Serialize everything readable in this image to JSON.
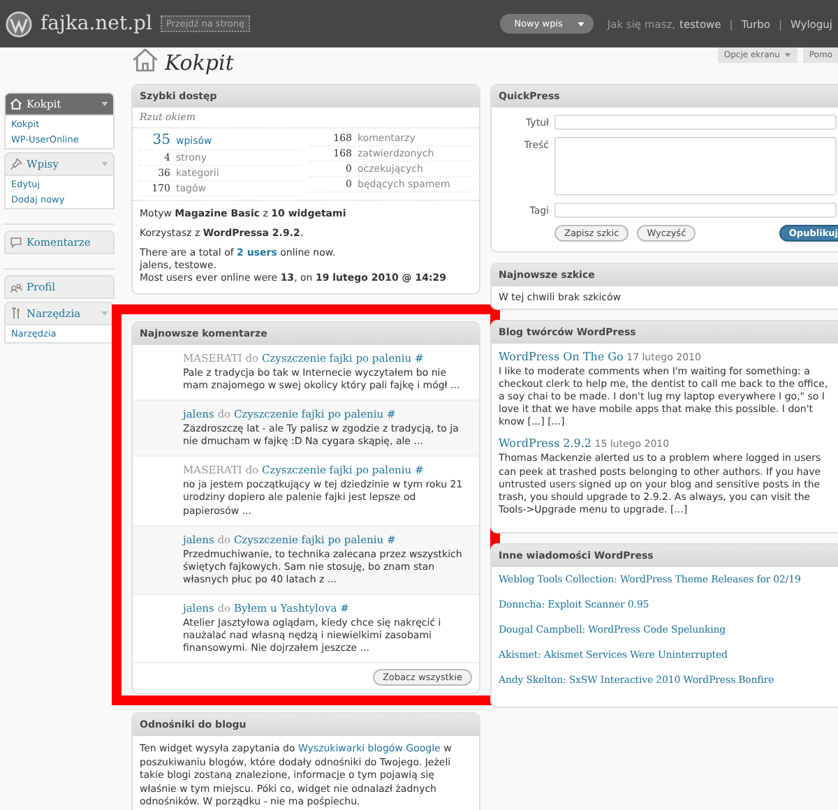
{
  "header": {
    "site_title": "fajka.net.pl",
    "visit_button": "Przejdź na stronę",
    "new_post": "Nowy wpis",
    "greeting": "Jak się masz,",
    "user": "testowe",
    "links": [
      {
        "separator": "|",
        "label": "Turbo"
      },
      {
        "separator": "|",
        "label": "Wyloguj"
      }
    ]
  },
  "screen_tabs": [
    "Opcje ekranu",
    "Pomo"
  ],
  "sidebar": [
    {
      "label": "Kokpit",
      "selected": true,
      "items": [
        "Kokpit",
        "WP-UserOnline"
      ]
    },
    {
      "label": "Wpisy",
      "selected": false,
      "items": [
        "Edytuj",
        "Dodaj nowy"
      ]
    },
    {
      "label": "Komentarze",
      "selected": false
    },
    {
      "label": "Profil",
      "selected": false
    },
    {
      "label": "Narzędzia",
      "selected": false,
      "items": [
        "Narzędzia"
      ]
    }
  ],
  "page_title": "Kokpit",
  "right_now": {
    "title": "Szybki dostęp",
    "subtitle": "Rzut okiem",
    "content": [
      {
        "count": "35",
        "label": "wpisów"
      },
      {
        "count": "4",
        "label": "strony"
      },
      {
        "count": "36",
        "label": "kategorii"
      },
      {
        "count": "170",
        "label": "tagów"
      }
    ],
    "discussion": [
      {
        "count": "168",
        "label": "komentarzy"
      },
      {
        "count": "168",
        "label": "zatwierdzonych"
      },
      {
        "count": "0",
        "label": "oczekujących"
      },
      {
        "count": "0",
        "label": "będących spamem"
      }
    ],
    "theme": "Motyw **Magazine Basic** z **10 widgetami**",
    "version": "Korzystasz z **WordPressa 2.9.2**.",
    "online": {
      "before": "There are a total of",
      "link": "2 users",
      "after": "online now."
    },
    "online_users": "jalens, testowe.",
    "record": "Most users ever online were **13**, on **19 lutego 2010 @ 14:29**"
  },
  "recent_comments": {
    "title": "Najnowsze komentarze",
    "items": [
      {
        "author": "MASERATI",
        "author_linked": false,
        "to": "do",
        "post": "Czyszczenie fajki po paleniu",
        "hash": "#",
        "excerpt": "Pale z tradycja bo tak w Internecie wyczytałem bo nie mam znajomego w swej okolicy który pali fajkę i mógł ..."
      },
      {
        "author": "jalens",
        "author_linked": true,
        "to": "do",
        "post": "Czyszczenie fajki po paleniu",
        "hash": "#",
        "excerpt": "Zazdroszczę lat - ale Ty palisz w zgodzie z tradycją, to ja nie dmucham w fajkę :D Na cygara skąpię, ale ..."
      },
      {
        "author": "MASERATI",
        "author_linked": false,
        "to": "do",
        "post": "Czyszczenie fajki po paleniu",
        "hash": "#",
        "excerpt": "no ja jestem początkujący w tej dziedzinie w tym roku 21 urodziny dopiero ale palenie fajki jest lepsze od papierosów ..."
      },
      {
        "author": "jalens",
        "author_linked": true,
        "to": "do",
        "post": "Czyszczenie fajki po paleniu",
        "hash": "#",
        "excerpt": "Przedmuchiwanie, to technika zalecana przez wszystkich świętych fajkowych. Sam nie stosuję, bo znam stan własnych płuc po 40 latach z ..."
      },
      {
        "author": "jalens",
        "author_linked": true,
        "to": "do",
        "post": "Byłem u Yashtylova",
        "hash": "#",
        "excerpt": "Atelier Jasztyłowa oglądam, kiedy chce się nakręcić i naużalać nad własną nędzą i niewielkimi zasobami finansowymi. Nie dojrzałem jeszcze ..."
      }
    ],
    "view_all": "Zobacz wszystkie"
  },
  "incoming_links": {
    "title": "Odnośniki do blogu",
    "before": "Ten widget wysyła zapytania do",
    "link": "Wyszukiwarki blogów Google",
    "after": "w poszukiwaniu blogów, które dodały odnośniki do Twojego. Jeżeli takie blogi zostaną znalezione, informacje o tym pojawią się właśnie w tym miejscu. Póki co, widget nie odnalazł żadnych odnośników. W porządku - nie ma pośpiechu."
  },
  "quickpress": {
    "title": "QuickPress",
    "fields": [
      {
        "label": "Tytuł",
        "kind": "input"
      },
      {
        "label": "Treść",
        "kind": "textarea"
      },
      {
        "label": "Tagi",
        "kind": "input"
      }
    ],
    "save": "Zapisz szkic",
    "reset": "Wyczyść",
    "publish": "Opublikuj"
  },
  "drafts": {
    "title": "Najnowsze szkice",
    "text": "W tej chwili brak szkiców"
  },
  "blog": {
    "title": "Blog twórców WordPress",
    "posts": [
      {
        "title": "WordPress On The Go",
        "date": "17 lutego 2010",
        "excerpt": "I like to moderate comments when I'm waiting for something: a checkout clerk to help me, the dentist to call me back to the office, a soy chai to be made. I don't lug my laptop everywhere I go,\" so I love it that we have mobile apps that make this possible. I don't know [...] [...]"
      },
      {
        "title": "WordPress 2.9.2",
        "date": "15 lutego 2010",
        "excerpt": "Thomas Mackenzie alerted us to a problem where logged in users can peek at trashed posts belonging to other authors. If you have untrusted users signed up on your blog and sensitive posts in the trash, you should upgrade to 2.9.2.  As always, you can visit the Tools->Upgrade menu to upgrade. [...]"
      }
    ]
  },
  "other_news": {
    "title": "Inne wiadomości WordPress",
    "items": [
      "Weblog Tools Collection: WordPress Theme Releases for 02/19",
      "Donncha: Exploit Scanner 0.95",
      "Dougal Campbell: WordPress Code Spelunking",
      "Akismet: Akismet Services Were Uninterrupted",
      "Andy Skelton: SxSW Interactive 2010 WordPress Bonfire"
    ]
  }
}
